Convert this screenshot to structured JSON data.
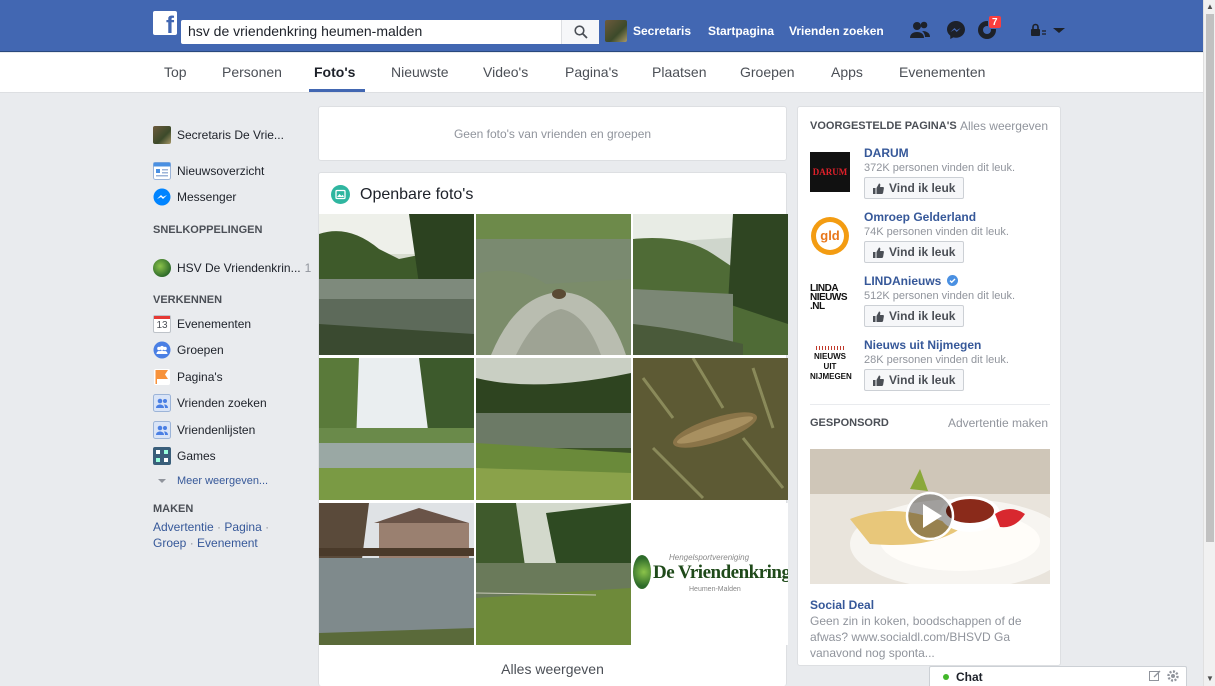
{
  "topbar": {
    "search_value": "hsv de vriendenkring heumen-malden",
    "me_label": "Secretaris",
    "home_label": "Startpagina",
    "find_friends_label": "Vrienden zoeken",
    "notification_count": "7",
    "brand_color": "#4267b2"
  },
  "tabs": [
    "Top",
    "Personen",
    "Foto's",
    "Nieuwste",
    "Video's",
    "Pagina's",
    "Plaatsen",
    "Groepen",
    "Apps",
    "Evenementen"
  ],
  "active_tab": "Foto's",
  "leftnav": {
    "profile": "Secretaris De Vrie...",
    "news_feed": "Nieuwsoverzicht",
    "messenger": "Messenger",
    "shortcuts_heading": "SNELKOPPELINGEN",
    "shortcut_group": "HSV De Vriendenkrin...",
    "shortcut_count": "1",
    "explore_heading": "VERKENNEN",
    "events": "Evenementen",
    "events_day": "13",
    "groups": "Groepen",
    "pages": "Pagina's",
    "find_friends": "Vrienden zoeken",
    "friend_lists": "Vriendenlijsten",
    "games": "Games",
    "see_more": "Meer weergeven...",
    "create_heading": "MAKEN",
    "create_ad": "Advertentie",
    "create_page": "Pagina",
    "create_group": "Groep",
    "create_event": "Evenement"
  },
  "main": {
    "no_friend_photos": "Geen foto's van vrienden en groepen",
    "public_photos_title": "Openbare foto's",
    "see_all": "Alles weergeven",
    "logo_tile": {
      "line1": "Hengelsportvereniging",
      "line2": "De Vriendenkring",
      "line3": "Heumen-Malden"
    }
  },
  "right": {
    "suggested_heading": "VOORGESTELDE PAGINA'S",
    "suggested_see_all": "Alles weergeven",
    "like_label": "Vind ik leuk",
    "pages": [
      {
        "name": "DARUM",
        "likes": "372K personen vinden dit leuk.",
        "logo_text": "DARUM"
      },
      {
        "name": "Omroep Gelderland",
        "likes": "74K personen vinden dit leuk.",
        "logo_text": "gld"
      },
      {
        "name": "LINDAnieuws",
        "likes": "512K personen vinden dit leuk.",
        "logo_text": "LINDA NIEUWS .NL"
      },
      {
        "name": "Nieuws uit Nijmegen",
        "likes": "28K personen vinden dit leuk.",
        "logo_text": "NIEUWS UIT NIJMEGEN"
      }
    ],
    "sponsored_heading": "GESPONSORD",
    "create_ad": "Advertentie maken",
    "ad_title": "Social Deal",
    "ad_body": "Geen zin in koken, boodschappen of de afwas? www.socialdl.com/BHSVD Ga vanavond nog sponta..."
  },
  "chat": {
    "label": "Chat",
    "status_color": "#42b72a"
  }
}
